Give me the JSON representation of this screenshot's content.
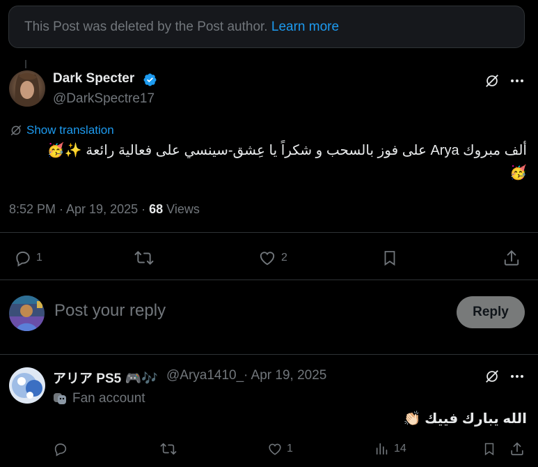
{
  "notice": {
    "text": "This Post was deleted by the Post author.",
    "link": "Learn more"
  },
  "post": {
    "author_name": "Dark Specter",
    "author_handle": "@DarkSpectre17",
    "verified": true,
    "show_translation": "Show translation",
    "text": "ألف مبروك Arya على فوز بالسحب و شكراً يا عِشق-سينسي على فعالية رائعة ✨🥳",
    "text_line2": "🥳",
    "timestamp": "8:52 PM · Apr 19, 2025 · ",
    "views_count": "68",
    "views_label": " Views",
    "actions": {
      "replies": "1",
      "reposts": "",
      "likes": "2"
    }
  },
  "composer": {
    "placeholder": "Post your reply",
    "button": "Reply"
  },
  "reply": {
    "author_name": "アリア PS5 🎮🎶",
    "author_handle": "@Arya1410_",
    "date": "· Apr 19, 2025",
    "fan_label": "Fan account",
    "text": "الله يبارك فييك 👏🏻",
    "actions": {
      "replies": "",
      "reposts": "",
      "likes": "1",
      "views": "14"
    }
  },
  "colors": {
    "accent": "#1d9bf0",
    "muted": "#71767b",
    "border": "#2f3336",
    "reply_button": "#787a7a"
  }
}
